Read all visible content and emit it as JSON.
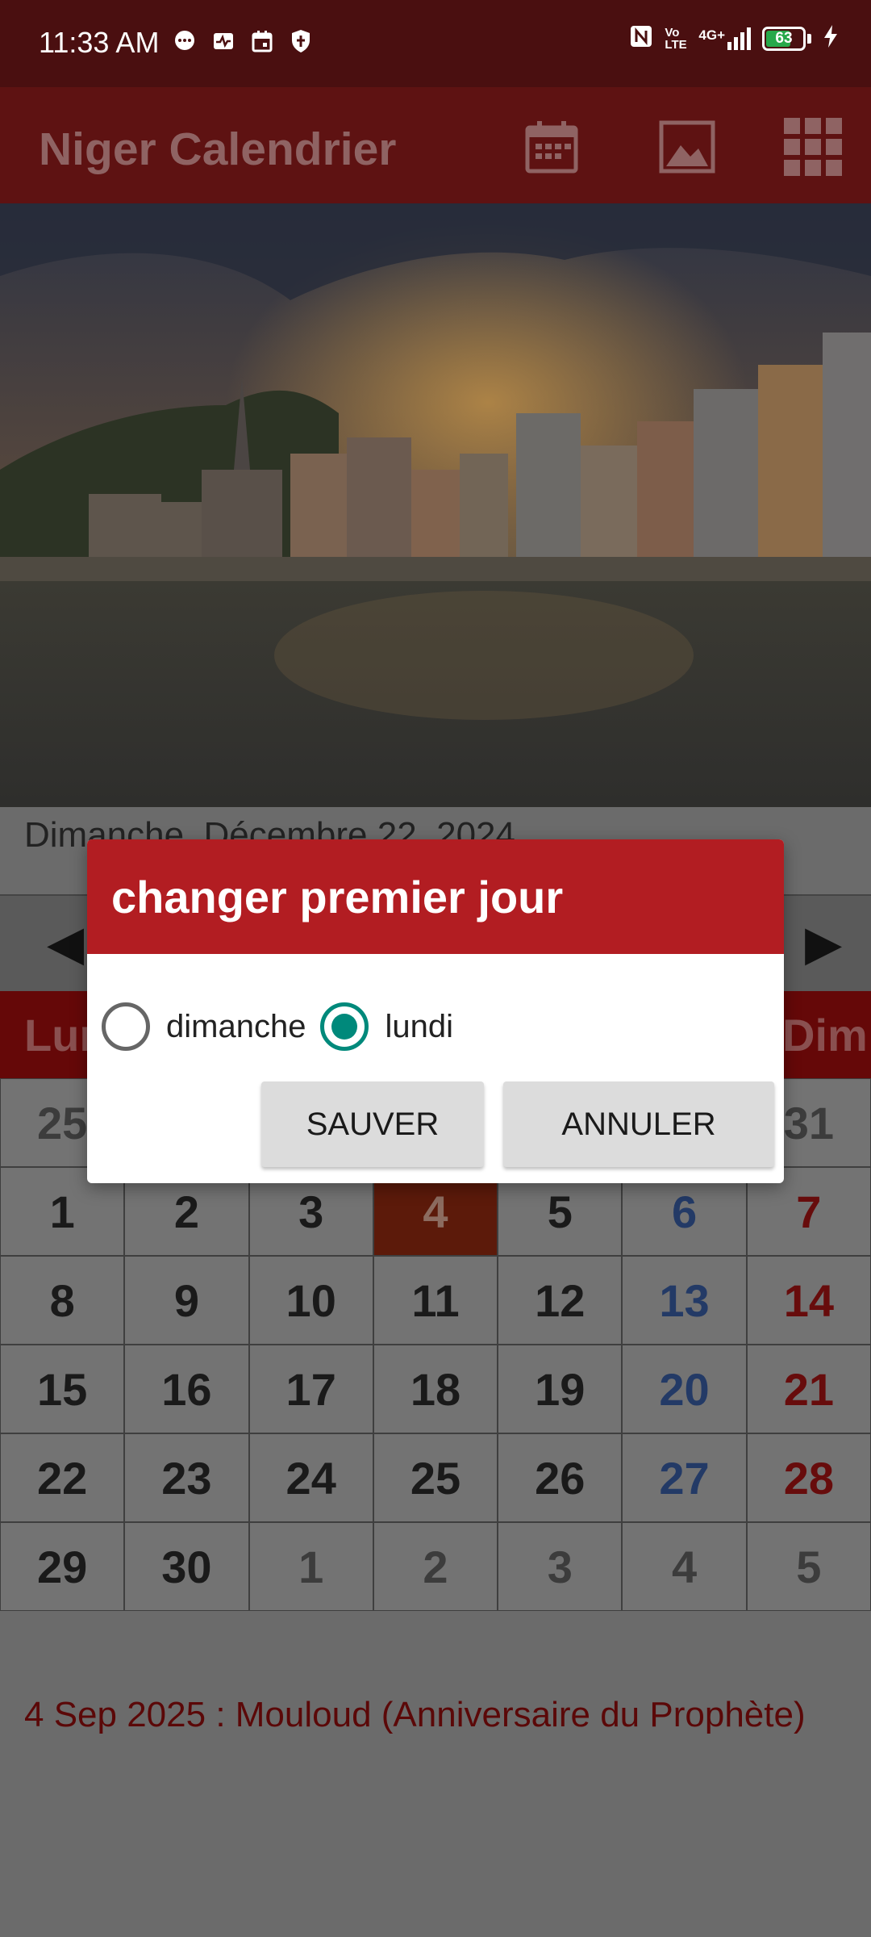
{
  "status_bar": {
    "time": "11:33 AM",
    "left_icons": [
      "chat-icon",
      "activity-icon",
      "calendar-notif-icon",
      "shield-icon"
    ],
    "right_icons": [
      "nfc-icon",
      "volte-icon",
      "signal-4g-icon"
    ],
    "network_label": "4G+",
    "volte_label": "Vo LTE",
    "battery_level": "63"
  },
  "app_bar": {
    "title": "Niger Calendrier",
    "actions": [
      "calendar-icon",
      "image-icon",
      "grid-menu-icon"
    ]
  },
  "calendar": {
    "current_date": "Dimanche, Décembre 22, 2024",
    "prev_arrow": "◀",
    "next_arrow": "▶",
    "weekday_visible_left": "Lun",
    "weekday_visible_right": "Dim",
    "top_row_visible": [
      "25",
      "31"
    ],
    "weeks": [
      [
        "1",
        "2",
        "3",
        "4",
        "5",
        "6",
        "7"
      ],
      [
        "8",
        "9",
        "10",
        "11",
        "12",
        "13",
        "14"
      ],
      [
        "15",
        "16",
        "17",
        "18",
        "19",
        "20",
        "21"
      ],
      [
        "22",
        "23",
        "24",
        "25",
        "26",
        "27",
        "28"
      ],
      [
        "29",
        "30",
        "1",
        "2",
        "3",
        "4",
        "5"
      ]
    ],
    "today": "4"
  },
  "holiday_text": "4 Sep 2025 : Mouloud (Anniversaire du Prophète)",
  "dialog": {
    "title": "changer premier jour",
    "options": [
      {
        "label": "dimanche",
        "checked": false
      },
      {
        "label": "lundi",
        "checked": true
      }
    ],
    "save_label": "SAUVER",
    "cancel_label": "ANNULER"
  },
  "colors": {
    "dialog_header": "#b21d22",
    "radio_accent": "#00897b",
    "app_bar_dimmed": "#5e1212"
  }
}
